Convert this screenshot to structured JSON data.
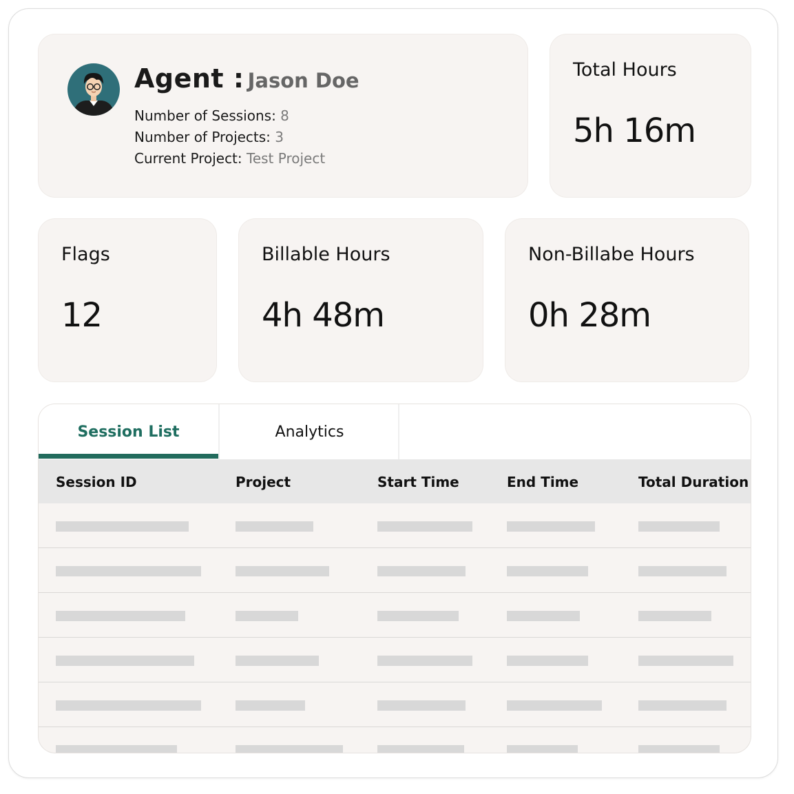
{
  "agent": {
    "label": "Agent :",
    "name": "Jason Doe",
    "sessions_label": "Number of Sessions:",
    "sessions_value": "8",
    "projects_label": "Number of Projects:",
    "projects_value": "3",
    "current_label": "Current Project:",
    "current_value": "Test Project"
  },
  "stats": {
    "total": {
      "label": "Total Hours",
      "value": "5h 16m"
    },
    "flags": {
      "label": "Flags",
      "value": "12"
    },
    "billable": {
      "label": "Billable Hours",
      "value": "4h 48m"
    },
    "nonbillable": {
      "label": "Non-Billabe Hours",
      "value": "0h 28m"
    }
  },
  "tabs": [
    {
      "label": "Session List",
      "active": true
    },
    {
      "label": "Analytics",
      "active": false
    }
  ],
  "table": {
    "columns": [
      "Session ID",
      "Project",
      "Start Time",
      "End Time",
      "Total Duration"
    ]
  },
  "colors": {
    "accent": "#226b5d",
    "card_bg": "#f7f4f2",
    "header_bg": "#e7e7e7",
    "placeholder": "#d8d8d8"
  }
}
